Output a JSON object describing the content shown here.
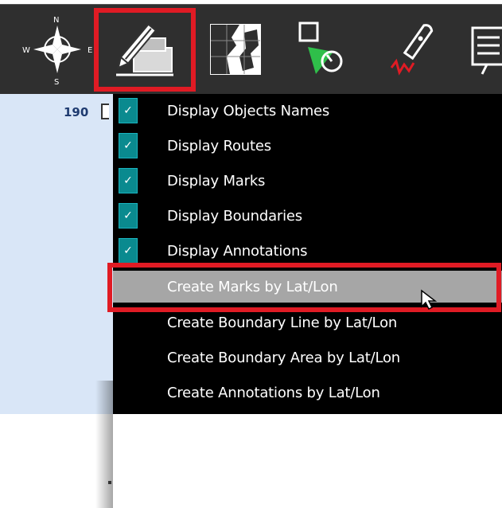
{
  "toolbar": {
    "buttons": [
      {
        "name": "compass-rose-icon",
        "letters": {
          "n": "N",
          "e": "E",
          "s": "S",
          "w": "W"
        }
      },
      {
        "name": "edit-objects-icon",
        "highlighted": true
      },
      {
        "name": "chart-map-icon"
      },
      {
        "name": "route-tool-icon"
      },
      {
        "name": "boat-track-icon"
      },
      {
        "name": "notes-icon"
      }
    ]
  },
  "left_panel": {
    "row_number": "190"
  },
  "menu": {
    "items": [
      {
        "label": "Display Objects Names",
        "checked": true
      },
      {
        "label": "Display Routes",
        "checked": true
      },
      {
        "label": "Display Marks",
        "checked": true
      },
      {
        "label": "Display Boundaries",
        "checked": true
      },
      {
        "label": "Display Annotations",
        "checked": true
      },
      {
        "label": "Create Marks by Lat/Lon",
        "checked": false,
        "hovered": true
      },
      {
        "label": "Create Boundary Line by Lat/Lon",
        "checked": false
      },
      {
        "label": "Create Boundary Area by Lat/Lon",
        "checked": false
      },
      {
        "label": "Create Annotations by Lat/Lon",
        "checked": false
      }
    ],
    "check_glyph": "✓"
  },
  "colors": {
    "highlight": "#e01b24",
    "check_bg": "#0a8a8f",
    "hover_bg": "#a6a6a6",
    "menu_bg": "#000000",
    "toolbar_bg": "#2f2f2f"
  }
}
